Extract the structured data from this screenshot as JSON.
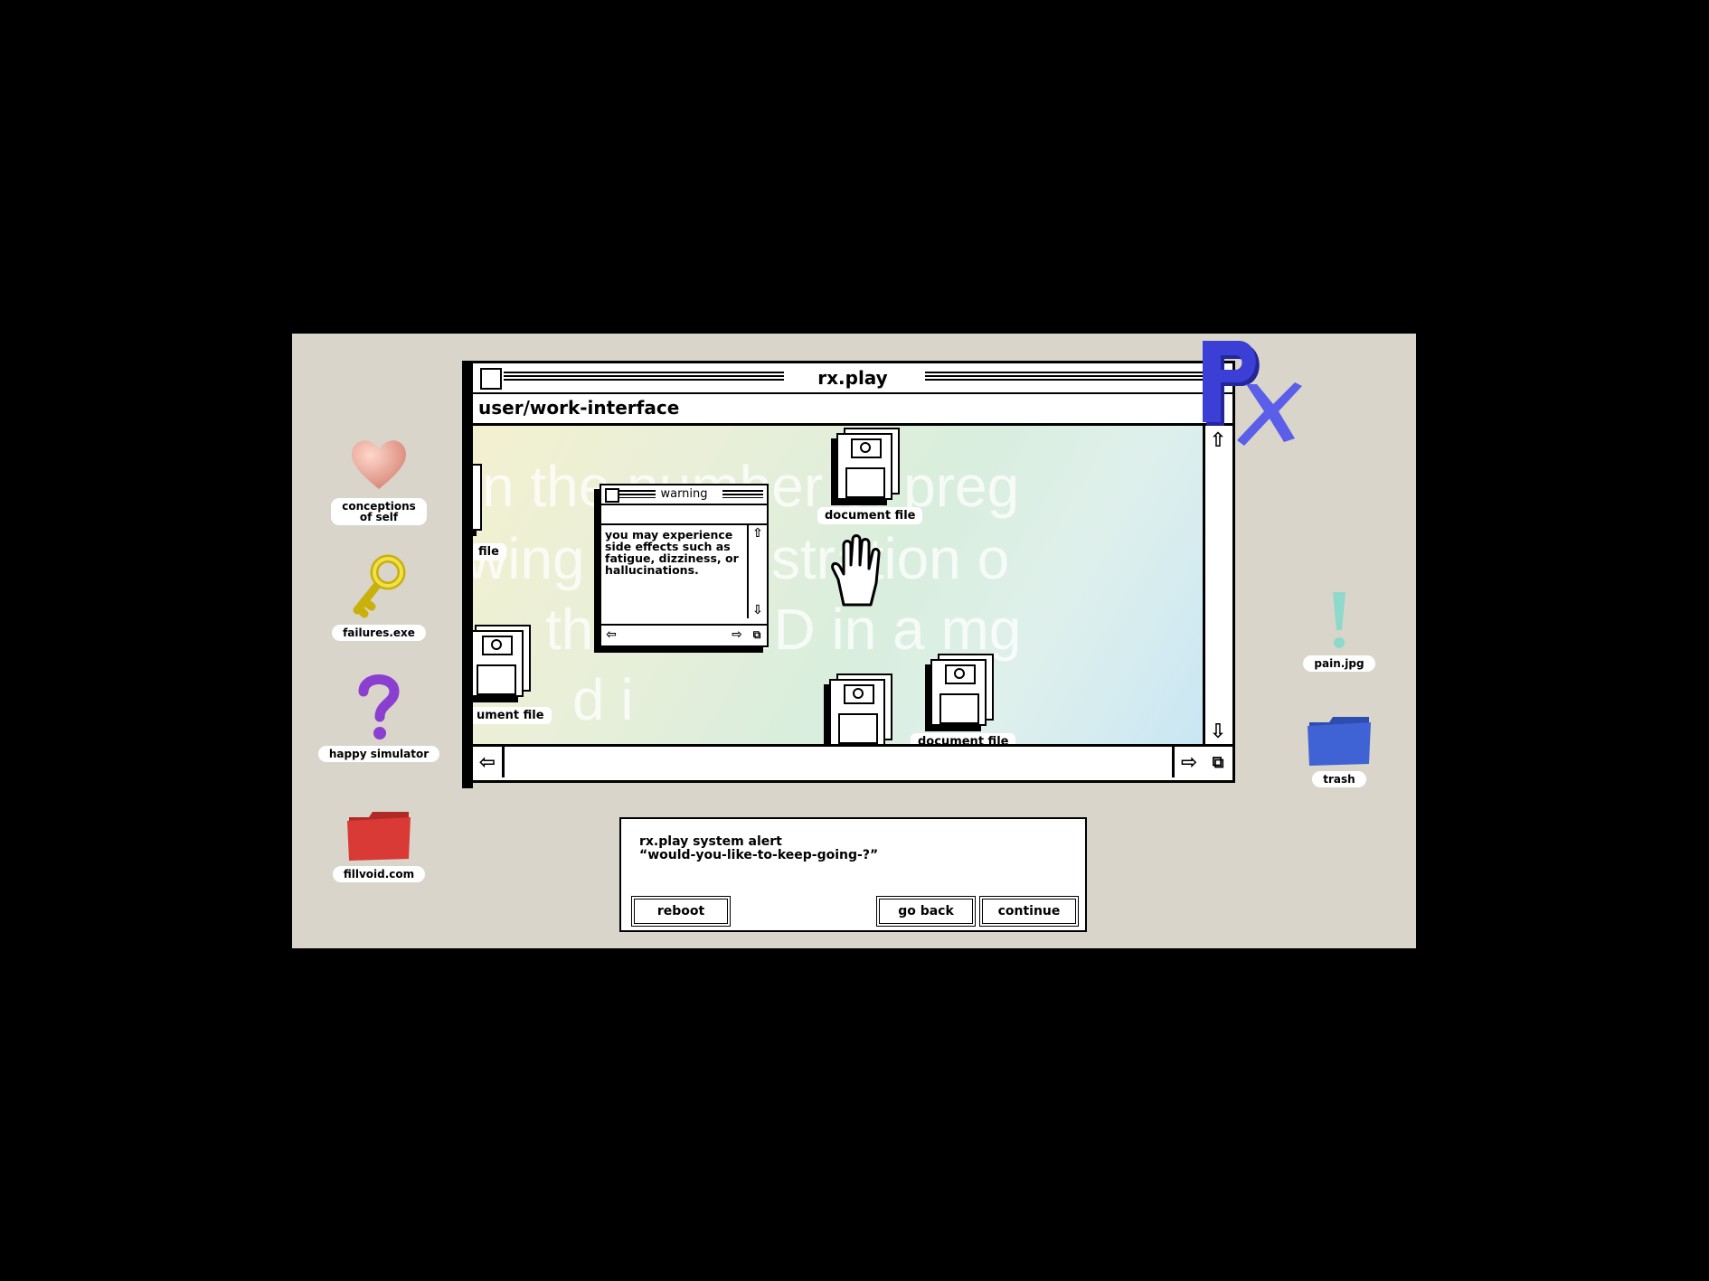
{
  "desktop": {
    "left_icons": [
      {
        "icon": "heart-icon",
        "label": "conceptions\nof self"
      },
      {
        "icon": "key-icon",
        "label": "failures.exe"
      },
      {
        "icon": "question-mark-icon",
        "label": "happy simulator"
      },
      {
        "icon": "folder-icon",
        "label": "fillvoid.com"
      }
    ],
    "right_icons": [
      {
        "icon": "exclamation-icon",
        "label": "pain.jpg"
      },
      {
        "icon": "folder-icon",
        "label": "trash"
      }
    ]
  },
  "window": {
    "title": "rx.play",
    "path": "user/work-interface",
    "background_lines": [
      "n the number of preg",
      "wing administration o",
      "the MRHD in a mg",
      "d i"
    ],
    "files": [
      {
        "label": "file"
      },
      {
        "label": "document file"
      },
      {
        "label": "ument file"
      },
      {
        "label": "document file"
      }
    ]
  },
  "warning": {
    "title": "warning",
    "message": "you may experience side effects such as fatigue, dizziness, or hallucinations."
  },
  "alert": {
    "line1": "rx.play system alert",
    "line2": "“would-you-like-to-keep-going-?”",
    "reboot_label": "reboot",
    "go_back_label": "go back",
    "continue_label": "continue"
  },
  "logo": {
    "text": "Rx"
  },
  "colors": {
    "desktop": "#d9d5ca",
    "logo": "#3b3fd6",
    "red_folder": "#d93a35",
    "blue_folder": "#3f63d4"
  }
}
